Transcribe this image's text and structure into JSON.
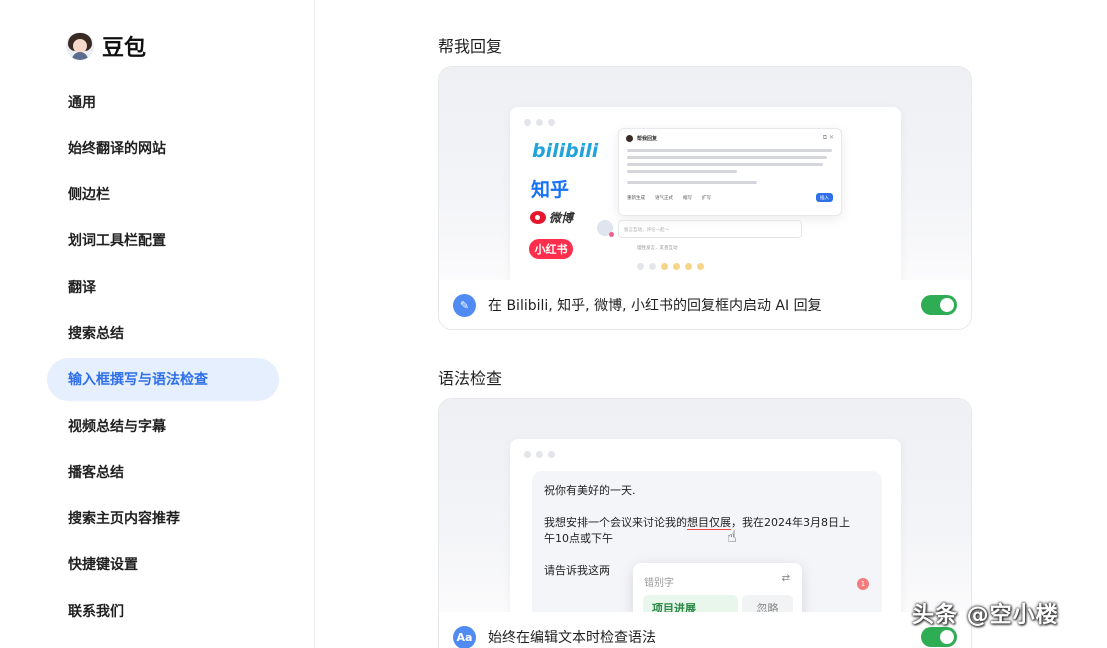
{
  "brand": {
    "name": "豆包",
    "icon": "doubao-avatar-icon"
  },
  "sidebar": {
    "items": [
      {
        "label": "通用",
        "active": false
      },
      {
        "label": "始终翻译的网站",
        "active": false
      },
      {
        "label": "侧边栏",
        "active": false
      },
      {
        "label": "划词工具栏配置",
        "active": false
      },
      {
        "label": "翻译",
        "active": false
      },
      {
        "label": "搜索总结",
        "active": false
      },
      {
        "label": "输入框撰写与语法检查",
        "active": true
      },
      {
        "label": "视频总结与字幕",
        "active": false
      },
      {
        "label": "播客总结",
        "active": false
      },
      {
        "label": "搜索主页内容推荐",
        "active": false
      },
      {
        "label": "快捷键设置",
        "active": false
      },
      {
        "label": "联系我们",
        "active": false
      }
    ]
  },
  "reply_section": {
    "title": "帮我回复",
    "preview": {
      "logos": {
        "bilibili": "bilibili",
        "zhihu": "知乎",
        "weibo": "微博",
        "xiaohongshu": "小红书"
      },
      "popup_title": "帮我回复",
      "popup_tools": [
        "重新生成",
        "语气正式",
        "缩写",
        "扩写"
      ],
      "popup_button": "插入",
      "comment_placeholder": "留言互动，评论一起～",
      "comment_hint": "理性发言，友善互动"
    },
    "row": {
      "icon": "magic-wand-icon",
      "label": "在 Bilibili, 知乎, 微博, 小红书的回复框内启动 AI 回复",
      "enabled": true
    }
  },
  "grammar_section": {
    "title": "语法检查",
    "preview": {
      "line1": "祝你有美好的一天.",
      "line2_before": "我想安排一个会议来讨论我的",
      "line2_error": "想目仅展",
      "line2_after": "，我在2024年3月8日上",
      "line3": "午10点或下午",
      "line4": "请告诉我这两",
      "popup_label": "错别字",
      "suggestion": "项目进展",
      "ignore": "忽略",
      "badge": "1"
    },
    "row": {
      "icon_text": "Aa",
      "label": "始终在编辑文本时检查语法",
      "enabled": true
    }
  },
  "watermark": "头条 @空小楼",
  "colors": {
    "accent": "#2f6fe8",
    "toggle_on": "#2fad55",
    "active_bg": "#e6effd"
  }
}
